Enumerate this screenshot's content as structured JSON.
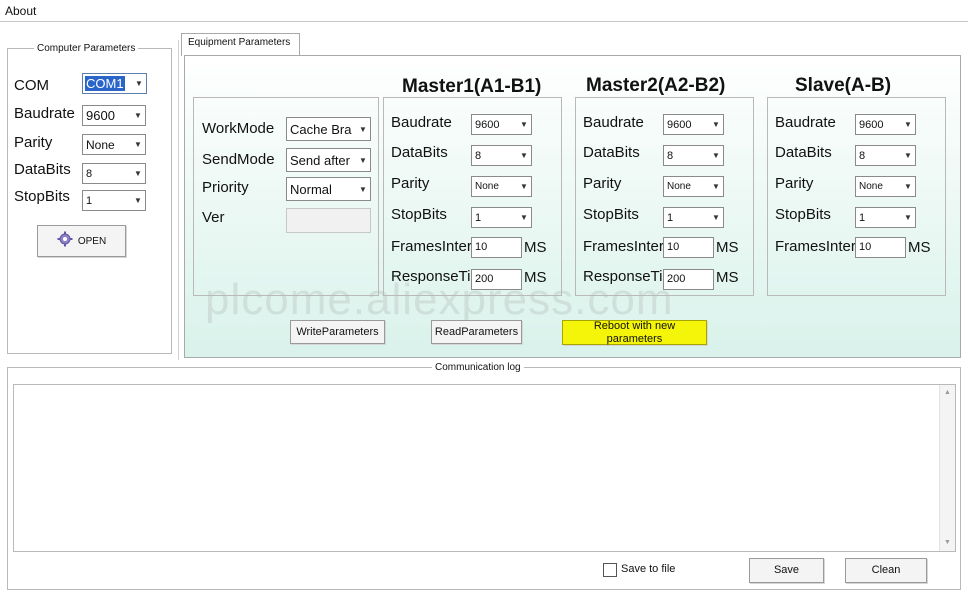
{
  "menu": {
    "about": "About"
  },
  "computer": {
    "group_title": "Computer Parameters",
    "com_label": "COM",
    "com_value": "COM1",
    "baud_label": "Baudrate",
    "baud_value": "9600",
    "parity_label": "Parity",
    "parity_value": "None",
    "databits_label": "DataBits",
    "databits_value": "8",
    "stopbits_label": "StopBits",
    "stopbits_value": "1",
    "open_label": "OPEN"
  },
  "equipment": {
    "tab_label": "Equipment Parameters",
    "workmode_label": "WorkMode",
    "workmode_value": "Cache Bra",
    "sendmode_label": "SendMode",
    "sendmode_value": "Send after",
    "priority_label": "Priority",
    "priority_value": "Normal",
    "ver_label": "Ver",
    "ver_value": "",
    "master1": {
      "title": "Master1(A1-B1)",
      "baud_label": "Baudrate",
      "baud_value": "9600",
      "databits_label": "DataBits",
      "databits_value": "8",
      "parity_label": "Parity",
      "parity_value": "None",
      "stopbits_label": "StopBits",
      "stopbits_value": "1",
      "frames_label": "FramesInter",
      "frames_value": "10",
      "frames_unit": "MS",
      "response_label": "ResponseTi",
      "response_value": "200",
      "response_unit": "MS"
    },
    "master2": {
      "title": "Master2(A2-B2)",
      "baud_label": "Baudrate",
      "baud_value": "9600",
      "databits_label": "DataBits",
      "databits_value": "8",
      "parity_label": "Parity",
      "parity_value": "None",
      "stopbits_label": "StopBits",
      "stopbits_value": "1",
      "frames_label": "FramesInter",
      "frames_value": "10",
      "frames_unit": "MS",
      "response_label": "ResponseTi",
      "response_value": "200",
      "response_unit": "MS"
    },
    "slave": {
      "title": "Slave(A-B)",
      "baud_label": "Baudrate",
      "baud_value": "9600",
      "databits_label": "DataBits",
      "databits_value": "8",
      "parity_label": "Parity",
      "parity_value": "None",
      "stopbits_label": "StopBits",
      "stopbits_value": "1",
      "frames_label": "FramesInter",
      "frames_value": "10",
      "frames_unit": "MS"
    },
    "write_label": "WriteParameters",
    "read_label": "ReadParameters",
    "reboot_label": "Reboot with new parameters",
    "watermark": "plcome.aliexpress.com"
  },
  "log": {
    "title": "Communication log",
    "content": "",
    "save_to_file_label": "Save to file",
    "save_label": "Save",
    "clean_label": "Clean"
  },
  "colors": {
    "panel_gradient_top": "#ffffff",
    "panel_gradient_bottom": "#dcf3ec",
    "reboot_bg": "#f5f50a"
  },
  "icons": {
    "open": "gear-icon",
    "dropdown": "chevron-down-icon"
  }
}
